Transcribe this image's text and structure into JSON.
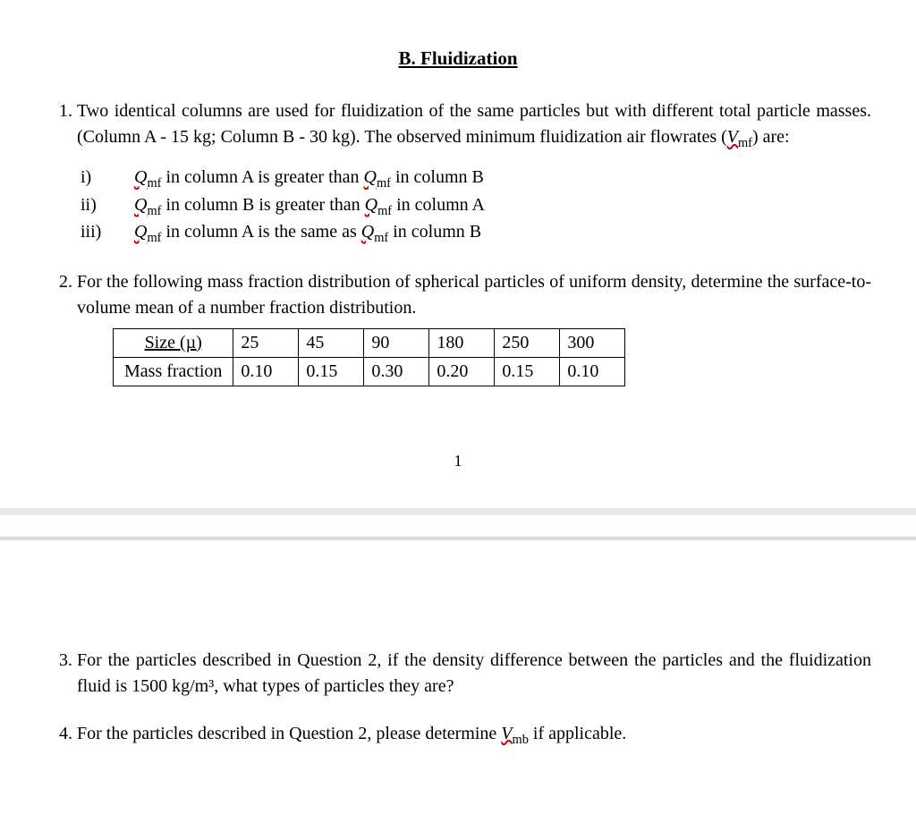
{
  "section_title": "B. Fluidization",
  "q1": {
    "num": "1.",
    "text_a": "Two identical columns are used for fluidization of the same particles but with different total particle masses. (Column A - 15 kg; Column B - 30 kg). The observed minimum fluidization air flowrates (",
    "vmf": "V",
    "vmf_sub": "mf",
    "text_b": ") are:",
    "opts": {
      "i_label": "i)",
      "ii_label": "ii)",
      "iii_label": "iii)",
      "q": "Q",
      "qsub": "mf",
      "i_mid": " in column A is greater than ",
      "i_end": " in column B",
      "ii_mid": " in column B is greater than ",
      "ii_end": " in column A",
      "iii_mid": " in column A is the same as ",
      "iii_end": " in column B"
    }
  },
  "q2": {
    "num": "2.",
    "text": "For the following mass fraction distribution of spherical particles of uniform density, determine the surface-to-volume mean of a number fraction distribution.",
    "table": {
      "row1_label": "Size (µ)",
      "row2_label": "Mass fraction",
      "sizes": [
        "25",
        "45",
        "90",
        "180",
        "250",
        "300"
      ],
      "fracs": [
        "0.10",
        "0.15",
        "0.30",
        "0.20",
        "0.15",
        "0.10"
      ]
    }
  },
  "page_number": "1",
  "q3": {
    "num": "3.",
    "text": "For the particles described in Question 2, if the density difference between the particles and the fluidization fluid is 1500 kg/m³, what types of particles they are?"
  },
  "q4": {
    "num": "4.",
    "text_a": "For the particles described in Question 2, please determine ",
    "v": "V",
    "vsub": "mb",
    "text_b": " if applicable."
  }
}
